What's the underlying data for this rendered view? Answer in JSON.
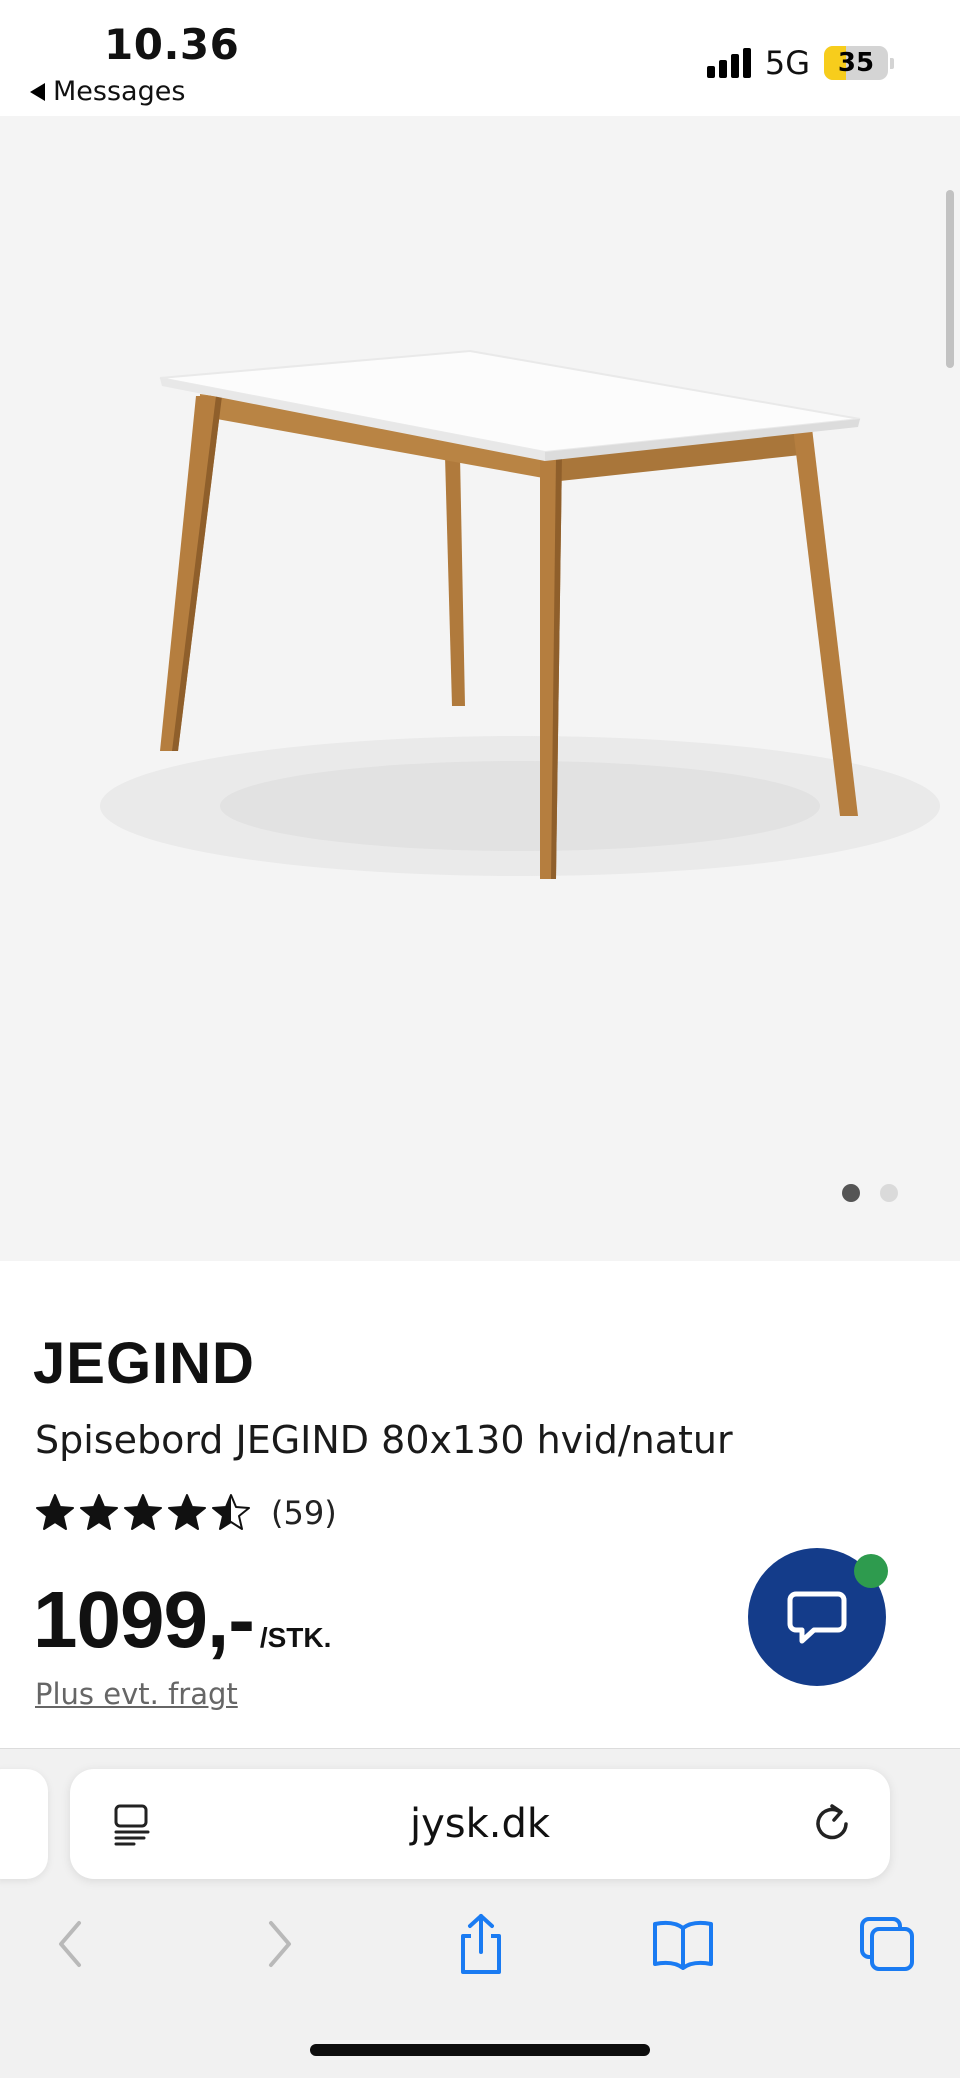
{
  "status_bar": {
    "time": "10.36",
    "back_label": "Messages",
    "network": "5G",
    "battery": "35",
    "battery_level": 0.35
  },
  "gallery": {
    "image_alt": "Spisebord JEGIND 80x130 hvid/natur",
    "page_count": 2,
    "current_page": 1
  },
  "product": {
    "brand": "JEGIND",
    "name": "Spisebord JEGIND 80x130 hvid/natur",
    "rating_value": 4.5,
    "rating_max": 5,
    "review_count": "(59)",
    "price": "1099,-",
    "price_unit": "/STK.",
    "freight_link": "Plus evt. fragt"
  },
  "browser": {
    "url": "jysk.dk",
    "icons": {
      "reader": "reader-mode-icon",
      "reload": "reload-icon",
      "back": "chevron-left-icon",
      "forward": "chevron-right-icon",
      "share": "share-icon",
      "bookmarks": "book-icon",
      "tabs": "tabs-icon"
    }
  },
  "colors": {
    "chat_button": "#143c8a",
    "online_indicator": "#2e9b4e",
    "safari_blue": "#1a7bf2",
    "battery_fill": "#f7cd1c"
  }
}
